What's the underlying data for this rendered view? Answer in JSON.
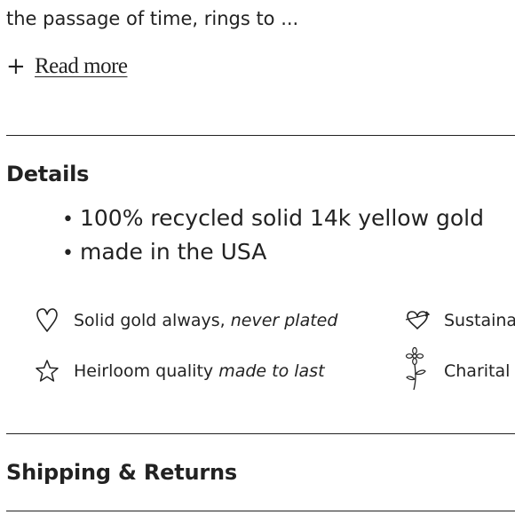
{
  "intro": {
    "text": "the passage of time, rings to ..."
  },
  "read_more": {
    "icon": "plus-icon",
    "label": "Read more"
  },
  "details": {
    "title": "Details",
    "bullets": [
      "100% recycled solid 14k yellow gold",
      "made in the USA"
    ]
  },
  "features": [
    {
      "icon": "heart-icon",
      "text": "Solid gold always, ",
      "emphasis": "never plated"
    },
    {
      "icon": "heart-arrow-icon",
      "text": "Sustaina",
      "emphasis": ""
    },
    {
      "icon": "star-icon",
      "text": "Heirloom quality ",
      "emphasis": "made to last"
    },
    {
      "icon": "flower-icon",
      "text": "Charital",
      "emphasis": ""
    }
  ],
  "shipping": {
    "title": "Shipping & Returns"
  }
}
